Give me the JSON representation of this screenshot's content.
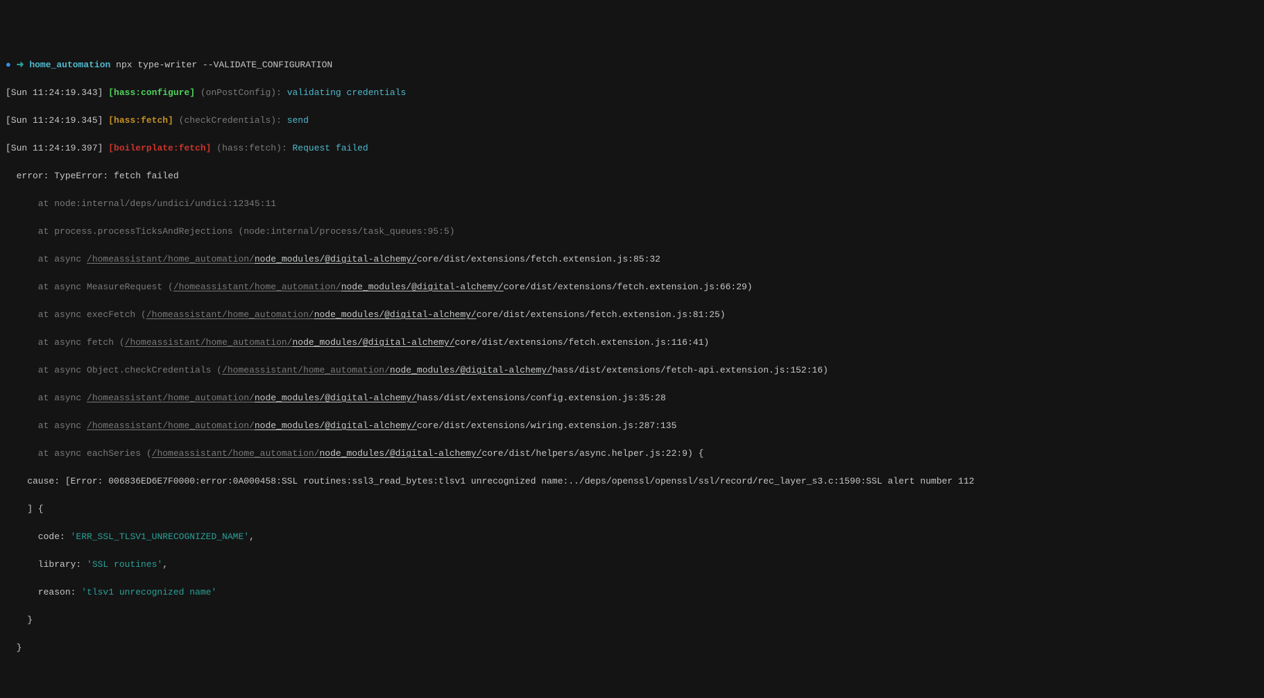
{
  "prompt": {
    "dot": "●",
    "arrow": "➜",
    "cwd": " home_automation",
    "cmd": " npx type-writer --VALIDATE_CONFIGURATION"
  },
  "l1": {
    "ts": "[Sun 11:24:19.343]",
    "tag": " [hass:configure]",
    "fn": " (onPostConfig)",
    "sep": ":",
    "msg": " validating credentials"
  },
  "l2": {
    "ts": "[Sun 11:24:19.345]",
    "tag": " [hass:fetch]",
    "fn": " (checkCredentials)",
    "sep": ":",
    "msg": " send"
  },
  "l3": {
    "ts": "[Sun 11:24:19.397]",
    "tag": " [boilerplate:fetch]",
    "fn": " (hass:fetch)",
    "sep": ":",
    "msg": " Request failed"
  },
  "err": "  error: TypeError: fetch failed",
  "st1": "      at node:internal/deps/undici/undici:12345:11",
  "st2": "      at process.processTicksAndRejections (node:internal/process/task_queues:95:5)",
  "st3a": "      at async ",
  "st3b": "/homeassistant/home_automation/",
  "st3c": "node_modules/",
  "st3d": "@digital-alchemy/",
  "st3e": "core/dist/extensions/fetch.extension.js:85:32",
  "st4a": "      at async MeasureRequest (",
  "st4b": "/homeassistant/home_automation/",
  "st4c": "node_modules/",
  "st4d": "@digital-alchemy/",
  "st4e": "core/dist/extensions/fetch.extension.js:66:29)",
  "st5a": "      at async execFetch (",
  "st5b": "/homeassistant/home_automation/",
  "st5c": "node_modules/",
  "st5d": "@digital-alchemy/",
  "st5e": "core/dist/extensions/fetch.extension.js:81:25)",
  "st6a": "      at async fetch (",
  "st6b": "/homeassistant/home_automation/",
  "st6c": "node_modules/",
  "st6d": "@digital-alchemy/",
  "st6e": "core/dist/extensions/fetch.extension.js:116:41)",
  "st7a": "      at async Object.checkCredentials (",
  "st7b": "/homeassistant/home_automation/",
  "st7c": "node_modules/",
  "st7d": "@digital-alchemy/",
  "st7e": "hass/dist/extensions/fetch-api.extension.js:152:16)",
  "st8a": "      at async ",
  "st8b": "/homeassistant/home_automation/",
  "st8c": "node_modules/",
  "st8d": "@digital-alchemy/",
  "st8e": "hass/dist/extensions/config.extension.js:35:28",
  "st9a": "      at async ",
  "st9b": "/homeassistant/home_automation/",
  "st9c": "node_modules/",
  "st9d": "@digital-alchemy/",
  "st9e": "core/dist/extensions/wiring.extension.js:287:135",
  "st10a": "      at async eachSeries (",
  "st10b": "/homeassistant/home_automation/",
  "st10c": "node_modules/",
  "st10d": "@digital-alchemy/",
  "st10e": "core/dist/helpers/async.helper.js:22:9) {",
  "cause": "    cause: [Error: 006836ED6E7F0000:error:0A000458:SSL routines:ssl3_read_bytes:tlsv1 unrecognized name:../deps/openssl/openssl/ssl/record/rec_layer_s3.c:1590:SSL alert number 112",
  "closeBracket": "    ] {",
  "codeK": "      code: ",
  "codeV": "'ERR_SSL_TLSV1_UNRECOGNIZED_NAME'",
  "codeC": ",",
  "libK": "      library: ",
  "libV": "'SSL routines'",
  "libC": ",",
  "reasonK": "      reason: ",
  "reasonV": "'tlsv1 unrecognized name'",
  "close1": "    }",
  "close2": "  }"
}
